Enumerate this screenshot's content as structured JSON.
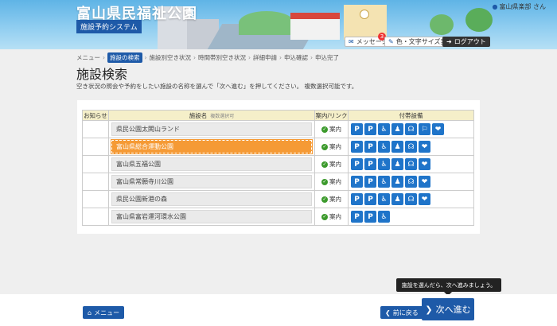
{
  "header": {
    "site_title": "富山県民福祉公園",
    "system_name": "施設予約システム",
    "user_name": "富山県楽部 さん",
    "message_label": "メッセージ",
    "message_count": "3",
    "color_size_label": "色・文字サイズ変更",
    "logout_label": "ログアウト"
  },
  "breadcrumb": [
    {
      "label": "メニュー"
    },
    {
      "label": "施設の検索",
      "current": true
    },
    {
      "label": "施設別空き状況"
    },
    {
      "label": "時間帯別空き状況"
    },
    {
      "label": "詳細申請"
    },
    {
      "label": "申込確認"
    },
    {
      "label": "申込完了"
    }
  ],
  "page": {
    "title": "施設検索",
    "instruction": "空き状況の照会や予約をしたい施設の名称を選んで「次へ進む」を押してください。 複数選択可能です。"
  },
  "table": {
    "headers": {
      "notice": "お知らせ",
      "name": "施設名",
      "name_sub": "複数選択可",
      "guide": "案内/リンク",
      "equipment": "付帯設備"
    },
    "guide_label": "案内",
    "rows": [
      {
        "name": "県民公園太閤山ランド",
        "selected": false,
        "equipment": [
          "parking",
          "bus-parking",
          "wheelchair",
          "accessible-toilet",
          "ostomate",
          "flag-park",
          "aed"
        ]
      },
      {
        "name": "富山県総合運動公園",
        "selected": true,
        "equipment": [
          "parking",
          "bus-parking",
          "wheelchair",
          "accessible-toilet",
          "ostomate",
          "aed"
        ]
      },
      {
        "name": "富山県五福公園",
        "selected": false,
        "equipment": [
          "parking",
          "bus-parking",
          "wheelchair",
          "accessible-toilet",
          "ostomate",
          "aed"
        ]
      },
      {
        "name": "富山県常願寺川公園",
        "selected": false,
        "equipment": [
          "parking",
          "bus-parking",
          "wheelchair",
          "accessible-toilet",
          "ostomate",
          "aed"
        ]
      },
      {
        "name": "県民公園新港の森",
        "selected": false,
        "equipment": [
          "parking",
          "bus-parking",
          "wheelchair",
          "accessible-toilet",
          "ostomate",
          "aed"
        ]
      },
      {
        "name": "富山県富岩運河環水公園",
        "selected": false,
        "equipment": [
          "parking",
          "bus-parking",
          "wheelchair"
        ]
      }
    ]
  },
  "footer": {
    "menu_label": "メニュー",
    "back_label": "前に戻る",
    "next_label": "次へ進む",
    "tooltip": "施設を選んだら、次へ進みましょう。"
  },
  "colors": {
    "primary": "#1e5aa8",
    "selected": "#f59a35",
    "equipment_icon": "#1f74c9",
    "header_bg": "#5fb4e6"
  }
}
